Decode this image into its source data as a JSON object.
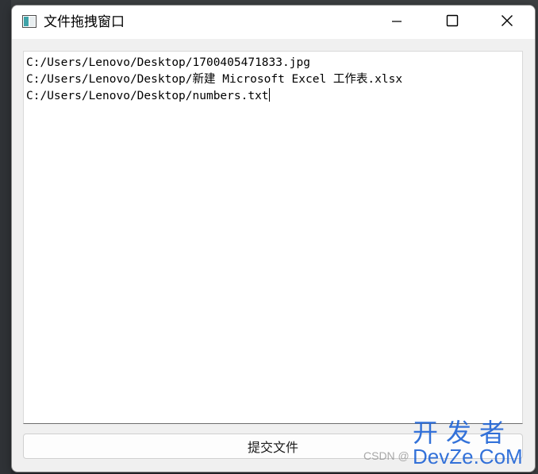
{
  "window": {
    "title": "文件拖拽窗口"
  },
  "editor": {
    "lines": [
      "C:/Users/Lenovo/Desktop/1700405471833.jpg",
      "C:/Users/Lenovo/Desktop/新建 Microsoft Excel 工作表.xlsx",
      "C:/Users/Lenovo/Desktop/numbers.txt"
    ]
  },
  "actions": {
    "submit_label": "提交文件"
  },
  "watermark": {
    "csdn": "CSDN @",
    "brand": "开发者",
    "domain": "DevZe.CoM"
  },
  "icons": {
    "app": "window-app-icon",
    "minimize": "minimize-icon",
    "maximize": "maximize-icon",
    "close": "close-icon"
  }
}
